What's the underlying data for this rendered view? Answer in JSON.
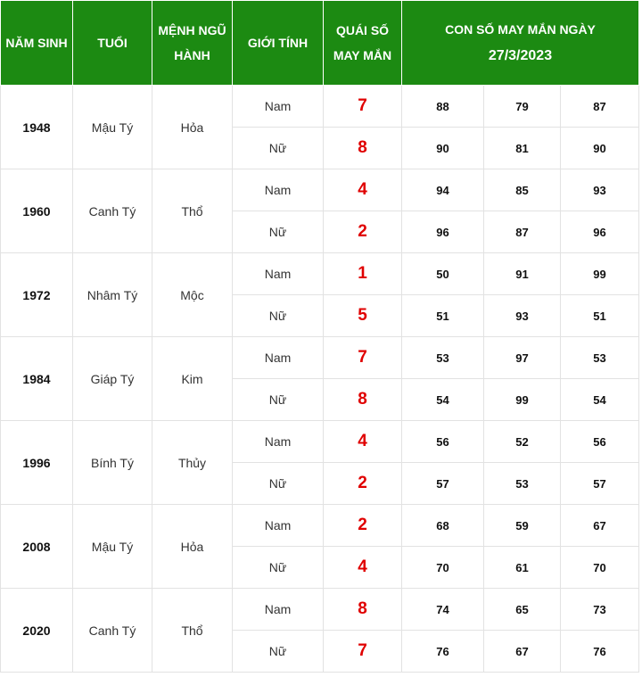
{
  "header": {
    "birth_year": "NĂM SINH",
    "age": "TUỔI",
    "element": "MỆNH NGŨ HÀNH",
    "gender": "GIỚI TÍNH",
    "lucky_trigram": "QUÁI SỐ MAY MẮN",
    "lucky_numbers_title": "CON SỐ MAY MẮN NGÀY",
    "lucky_numbers_date": "27/3/2023"
  },
  "rows": [
    {
      "year": "1948",
      "age": "Mậu Tý",
      "element": "Hỏa",
      "entries": [
        {
          "gender": "Nam",
          "lucky": "7",
          "nums": [
            "88",
            "79",
            "87"
          ]
        },
        {
          "gender": "Nữ",
          "lucky": "8",
          "nums": [
            "90",
            "81",
            "90"
          ]
        }
      ]
    },
    {
      "year": "1960",
      "age": "Canh Tý",
      "element": "Thổ",
      "entries": [
        {
          "gender": "Nam",
          "lucky": "4",
          "nums": [
            "94",
            "85",
            "93"
          ]
        },
        {
          "gender": "Nữ",
          "lucky": "2",
          "nums": [
            "96",
            "87",
            "96"
          ]
        }
      ]
    },
    {
      "year": "1972",
      "age": "Nhâm Tý",
      "element": "Mộc",
      "entries": [
        {
          "gender": "Nam",
          "lucky": "1",
          "nums": [
            "50",
            "91",
            "99"
          ]
        },
        {
          "gender": "Nữ",
          "lucky": "5",
          "nums": [
            "51",
            "93",
            "51"
          ]
        }
      ]
    },
    {
      "year": "1984",
      "age": "Giáp Tý",
      "element": "Kim",
      "entries": [
        {
          "gender": "Nam",
          "lucky": "7",
          "nums": [
            "53",
            "97",
            "53"
          ]
        },
        {
          "gender": "Nữ",
          "lucky": "8",
          "nums": [
            "54",
            "99",
            "54"
          ]
        }
      ]
    },
    {
      "year": "1996",
      "age": "Bính Tý",
      "element": "Thủy",
      "entries": [
        {
          "gender": "Nam",
          "lucky": "4",
          "nums": [
            "56",
            "52",
            "56"
          ]
        },
        {
          "gender": "Nữ",
          "lucky": "2",
          "nums": [
            "57",
            "53",
            "57"
          ]
        }
      ]
    },
    {
      "year": "2008",
      "age": "Mậu Tý",
      "element": "Hỏa",
      "entries": [
        {
          "gender": "Nam",
          "lucky": "2",
          "nums": [
            "68",
            "59",
            "67"
          ]
        },
        {
          "gender": "Nữ",
          "lucky": "4",
          "nums": [
            "70",
            "61",
            "70"
          ]
        }
      ]
    },
    {
      "year": "2020",
      "age": "Canh Tý",
      "element": "Thổ",
      "entries": [
        {
          "gender": "Nam",
          "lucky": "8",
          "nums": [
            "74",
            "65",
            "73"
          ]
        },
        {
          "gender": "Nữ",
          "lucky": "7",
          "nums": [
            "76",
            "67",
            "76"
          ]
        }
      ]
    }
  ],
  "colors": {
    "header_bg": "#1c8a12",
    "header_text": "#ffffff",
    "lucky_number": "#e00000",
    "border": "#e2e2e2"
  }
}
